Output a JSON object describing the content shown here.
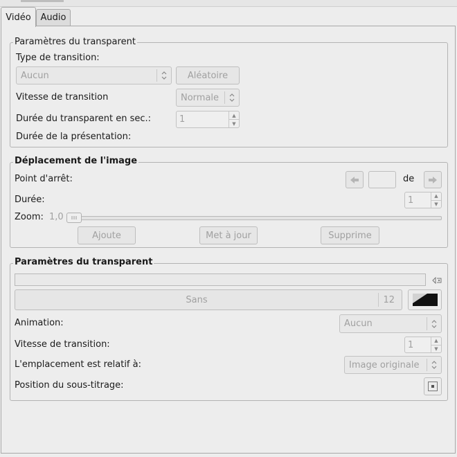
{
  "tabs": {
    "video": "Vidéo",
    "audio": "Audio"
  },
  "slide_params": {
    "title": "Paramètres du transparent",
    "transition_type_label": "Type de transition:",
    "transition_type_value": "Aucun",
    "random_button": "Aléatoire",
    "transition_speed_label": "Vitesse de transition",
    "transition_speed_value": "Normale",
    "slide_duration_label": "Durée du transparent en sec.:",
    "slide_duration_value": "1",
    "presentation_duration_label": "Durée de la présentation:"
  },
  "image_motion": {
    "title": "Déplacement de l'image",
    "stop_point_label": "Point d'arrêt:",
    "of_label": "de",
    "duration_label": "Durée:",
    "duration_value": "1",
    "zoom_label": "Zoom:",
    "zoom_value": "1,0",
    "add_button": "Ajoute",
    "update_button": "Met à jour",
    "delete_button": "Supprime"
  },
  "slide_text": {
    "title": "Paramètres du transparent",
    "font_name": "Sans",
    "font_size": "12",
    "animation_label": "Animation:",
    "animation_value": "Aucun",
    "transition_speed_label": "Vitesse de transition:",
    "transition_speed_value": "1",
    "placement_label": "L'emplacement est relatif à:",
    "placement_value": "Image originale",
    "subtitle_position_label": "Position du sous-titrage:"
  },
  "icons": {
    "prev": "left-arrow-icon",
    "next": "right-arrow-icon",
    "clear": "clear-icon",
    "color": "color-swatch-icon",
    "position": "position-icon"
  }
}
